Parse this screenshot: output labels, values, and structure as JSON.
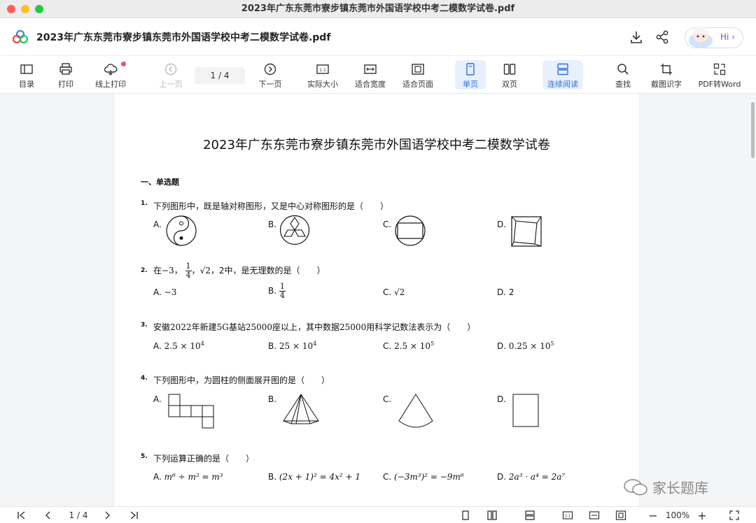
{
  "window": {
    "title": "2023年广东东莞市寮步镇东莞市外国语学校中考二模数学试卷.pdf"
  },
  "header": {
    "doc_title": "2023年广东东莞市寮步镇东莞市外国语学校中考二模数学试卷.pdf",
    "hi_label": "Hi",
    "icons": [
      "download-icon",
      "share-icon"
    ]
  },
  "toolbar": {
    "toc": "目录",
    "print": "打印",
    "online_print": "线上打印",
    "prev": "上一页",
    "page_indicator": "1  /  4",
    "next": "下一页",
    "actual_size": "实际大小",
    "fit_width": "适合宽度",
    "fit_page": "适合页面",
    "single": "单页",
    "double": "双页",
    "continuous": "连续阅读",
    "find": "查找",
    "ocr": "截图识字",
    "pdf2word": "PDF转Word",
    "actual_size_glyph": "1:1"
  },
  "document": {
    "title": "2023年广东东莞市寮步镇东莞市外国语学校中考二模数学试卷",
    "section": "一、单选题",
    "questions": [
      {
        "num": "1.",
        "text": "下列图形中，既是轴对称图形，又是中心对称图形的是（　　）",
        "options": [
          "A.",
          "B.",
          "C.",
          "D."
        ]
      },
      {
        "num": "2.",
        "text_pre": "在",
        "neg3": "−3，",
        "frac_num": "1",
        "frac_den": "4",
        "sqrt": "√2",
        "text_post": "，2中，是无理数的是（　　）",
        "options": [
          "A. ",
          "B. ",
          "C. ",
          "D. "
        ],
        "optA": "−3",
        "optC": "√2",
        "optD": "2"
      },
      {
        "num": "3.",
        "text_a": "安徽",
        "year": "2022",
        "text_b": "年新建",
        "g": "5G",
        "text_c": "基站",
        "n1": "25000",
        "text_d": "座以上，其中数据",
        "n2": "25000",
        "text_e": "用科学记数法表示为（　　）",
        "options": [
          "A. ",
          "B. ",
          "C. ",
          "D. "
        ],
        "vals": [
          "2.5 × 10",
          "25 × 10",
          "2.5 × 10",
          "0.25 × 10"
        ],
        "exps": [
          "4",
          "4",
          "5",
          "5"
        ]
      },
      {
        "num": "4.",
        "text": "下列图形中，为圆柱的侧面展开图的是（　　）",
        "options": [
          "A.",
          "B.",
          "C.",
          "D."
        ]
      },
      {
        "num": "5.",
        "text": "下列运算正确的是（　　）",
        "options": [
          "A. ",
          "B. ",
          "C. ",
          "D. "
        ],
        "math": [
          "m⁶ ÷ m² = m³",
          "(2x + 1)² = 4x² + 1",
          "(−3m³)² = −9m⁶",
          "2a³ · a⁴ = 2a⁷"
        ]
      }
    ]
  },
  "statusbar": {
    "page": "1  /  4",
    "zoom": "100%",
    "zoom_minus": "−",
    "zoom_plus": "+",
    "actual_glyph": "1:1"
  },
  "watermark": {
    "text": "家长题库"
  },
  "colors": {
    "accent": "#2f6fe0",
    "active_bg": "#e8f0fe",
    "badge": "#f0506e"
  }
}
